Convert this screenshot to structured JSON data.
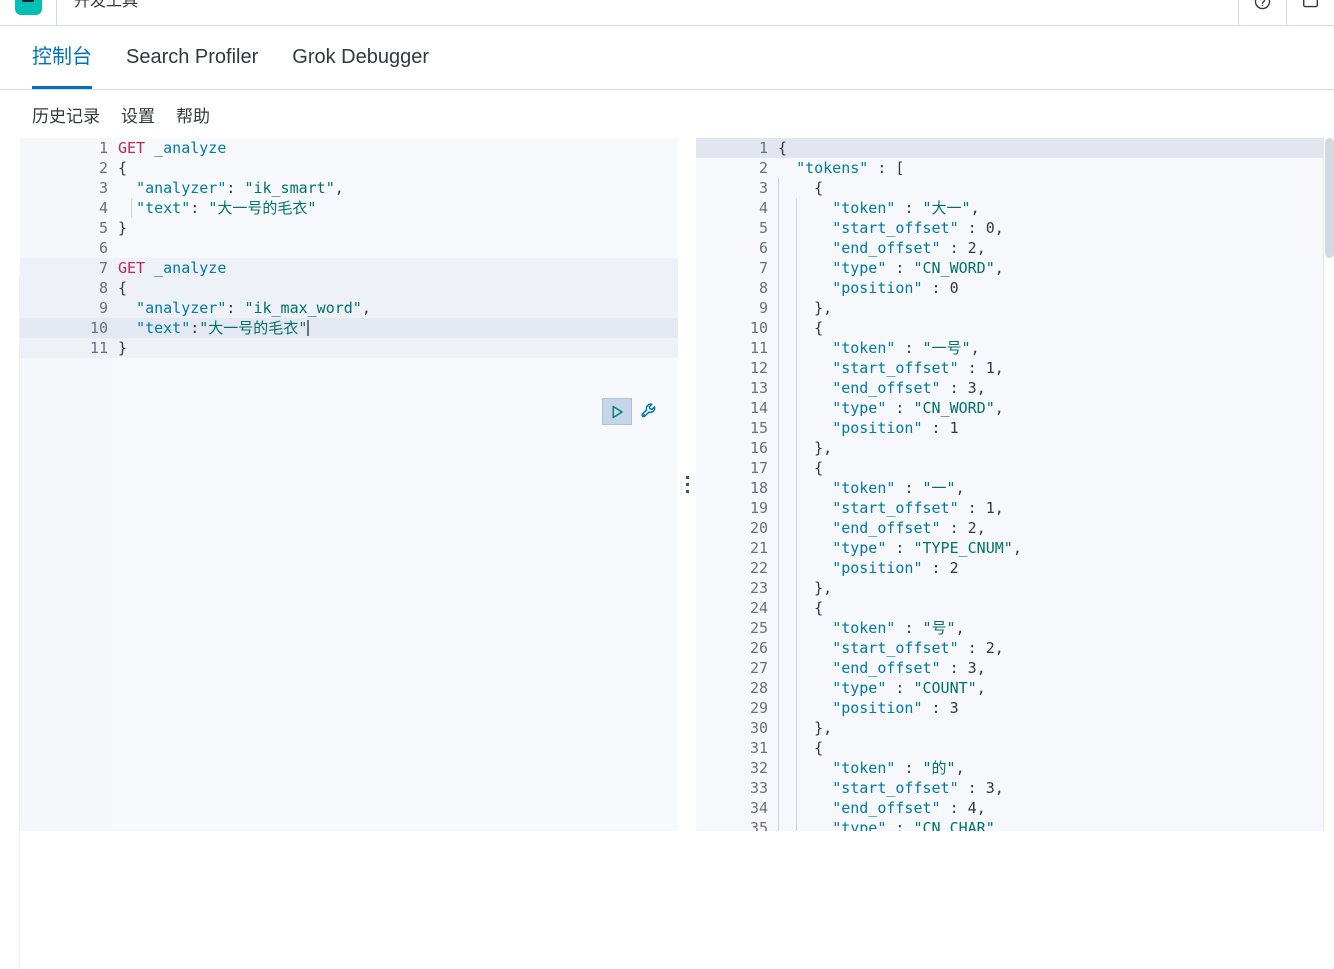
{
  "topbar": {
    "logo_icon": "elastic-logo",
    "title": "开发工具",
    "help_icon": "help-icon",
    "account_icon": "account-icon"
  },
  "tabs": [
    {
      "label": "控制台",
      "active": true
    },
    {
      "label": "Search Profiler",
      "active": false
    },
    {
      "label": "Grok Debugger",
      "active": false
    }
  ],
  "submenu": [
    {
      "label": "历史记录"
    },
    {
      "label": "设置"
    },
    {
      "label": "帮助"
    }
  ],
  "editor": {
    "actions": {
      "play_icon": "play-triangle-icon",
      "wrench_icon": "wrench-icon"
    },
    "drag_handle_icon": "vertical-dots-drag-handle",
    "active_line": 10,
    "cursor_line": 10,
    "lines": [
      {
        "n": 1,
        "fold": "",
        "text": "GET _analyze"
      },
      {
        "n": 2,
        "fold": "▾",
        "text": "{"
      },
      {
        "n": 3,
        "fold": "",
        "text": "  \"analyzer\": \"ik_smart\","
      },
      {
        "n": 4,
        "fold": "",
        "text": "  \"text\": \"大一号的毛衣\""
      },
      {
        "n": 5,
        "fold": "▴",
        "text": "}"
      },
      {
        "n": 6,
        "fold": "",
        "text": ""
      },
      {
        "n": 7,
        "fold": "",
        "text": "GET _analyze"
      },
      {
        "n": 8,
        "fold": "▾",
        "text": "{"
      },
      {
        "n": 9,
        "fold": "",
        "text": "  \"analyzer\": \"ik_max_word\","
      },
      {
        "n": 10,
        "fold": "",
        "text": "  \"text\":\"大一号的毛衣\""
      },
      {
        "n": 11,
        "fold": "▴",
        "text": "}"
      }
    ]
  },
  "output": {
    "active_line": 1,
    "lines": [
      {
        "n": 1,
        "fold": "▾",
        "text": "{"
      },
      {
        "n": 2,
        "fold": "▾",
        "text": "  \"tokens\" : ["
      },
      {
        "n": 3,
        "fold": "▾",
        "text": "    {"
      },
      {
        "n": 4,
        "fold": "",
        "text": "      \"token\" : \"大一\","
      },
      {
        "n": 5,
        "fold": "",
        "text": "      \"start_offset\" : 0,"
      },
      {
        "n": 6,
        "fold": "",
        "text": "      \"end_offset\" : 2,"
      },
      {
        "n": 7,
        "fold": "",
        "text": "      \"type\" : \"CN_WORD\","
      },
      {
        "n": 8,
        "fold": "",
        "text": "      \"position\" : 0"
      },
      {
        "n": 9,
        "fold": "▴",
        "text": "    },"
      },
      {
        "n": 10,
        "fold": "▾",
        "text": "    {"
      },
      {
        "n": 11,
        "fold": "",
        "text": "      \"token\" : \"一号\","
      },
      {
        "n": 12,
        "fold": "",
        "text": "      \"start_offset\" : 1,"
      },
      {
        "n": 13,
        "fold": "",
        "text": "      \"end_offset\" : 3,"
      },
      {
        "n": 14,
        "fold": "",
        "text": "      \"type\" : \"CN_WORD\","
      },
      {
        "n": 15,
        "fold": "",
        "text": "      \"position\" : 1"
      },
      {
        "n": 16,
        "fold": "▴",
        "text": "    },"
      },
      {
        "n": 17,
        "fold": "▾",
        "text": "    {"
      },
      {
        "n": 18,
        "fold": "",
        "text": "      \"token\" : \"一\","
      },
      {
        "n": 19,
        "fold": "",
        "text": "      \"start_offset\" : 1,"
      },
      {
        "n": 20,
        "fold": "",
        "text": "      \"end_offset\" : 2,"
      },
      {
        "n": 21,
        "fold": "",
        "text": "      \"type\" : \"TYPE_CNUM\","
      },
      {
        "n": 22,
        "fold": "",
        "text": "      \"position\" : 2"
      },
      {
        "n": 23,
        "fold": "▴",
        "text": "    },"
      },
      {
        "n": 24,
        "fold": "▾",
        "text": "    {"
      },
      {
        "n": 25,
        "fold": "",
        "text": "      \"token\" : \"号\","
      },
      {
        "n": 26,
        "fold": "",
        "text": "      \"start_offset\" : 2,"
      },
      {
        "n": 27,
        "fold": "",
        "text": "      \"end_offset\" : 3,"
      },
      {
        "n": 28,
        "fold": "",
        "text": "      \"type\" : \"COUNT\","
      },
      {
        "n": 29,
        "fold": "",
        "text": "      \"position\" : 3"
      },
      {
        "n": 30,
        "fold": "▴",
        "text": "    },"
      },
      {
        "n": 31,
        "fold": "▾",
        "text": "    {"
      },
      {
        "n": 32,
        "fold": "",
        "text": "      \"token\" : \"的\","
      },
      {
        "n": 33,
        "fold": "",
        "text": "      \"start_offset\" : 3,"
      },
      {
        "n": 34,
        "fold": "",
        "text": "      \"end_offset\" : 4,"
      },
      {
        "n": 35,
        "fold": "",
        "text": "      \"type\" : \"CN_CHAR\""
      }
    ]
  },
  "colors": {
    "accent": "#0071c2",
    "brand": "#00bfb3",
    "method": "#c0255f",
    "key": "#0079a5",
    "string": "#00726b",
    "highlight": "#e3e8f2"
  }
}
